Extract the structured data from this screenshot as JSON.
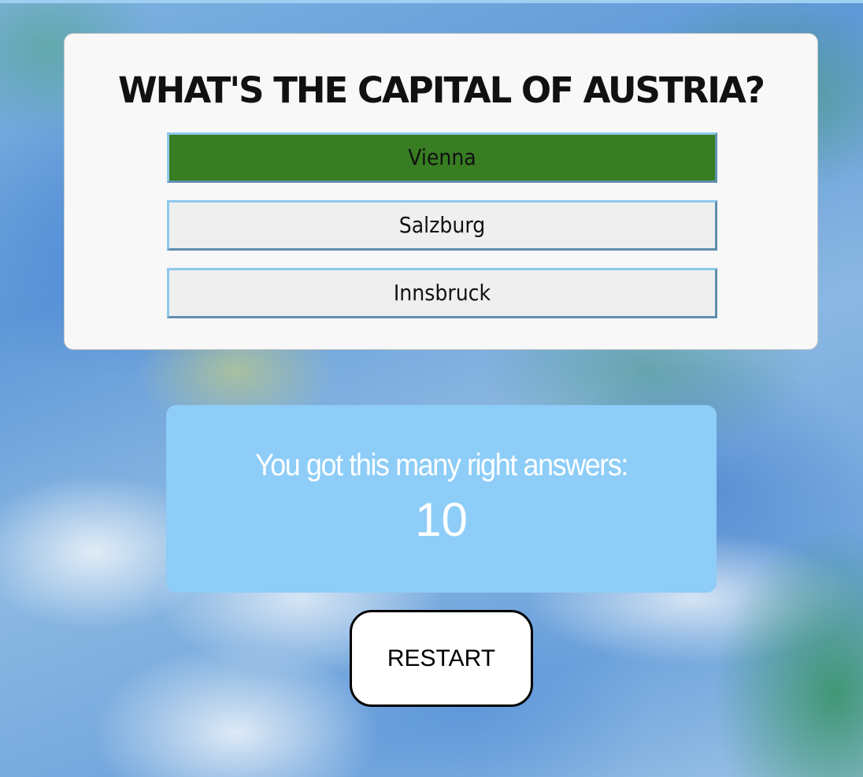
{
  "quiz": {
    "question": "WHAT'S THE CAPITAL OF AUSTRIA?",
    "answers": [
      {
        "label": "Vienna",
        "state": "correct"
      },
      {
        "label": "Salzburg",
        "state": "default"
      },
      {
        "label": "Innsbruck",
        "state": "default"
      }
    ]
  },
  "score": {
    "label": "You got this many right answers:",
    "value": "10"
  },
  "restart": {
    "label": "RESTART"
  },
  "colors": {
    "correct_answer": "#387d22",
    "default_answer": "#efefef",
    "score_box": "#8dcdf8",
    "card": "#f8f8f8"
  }
}
